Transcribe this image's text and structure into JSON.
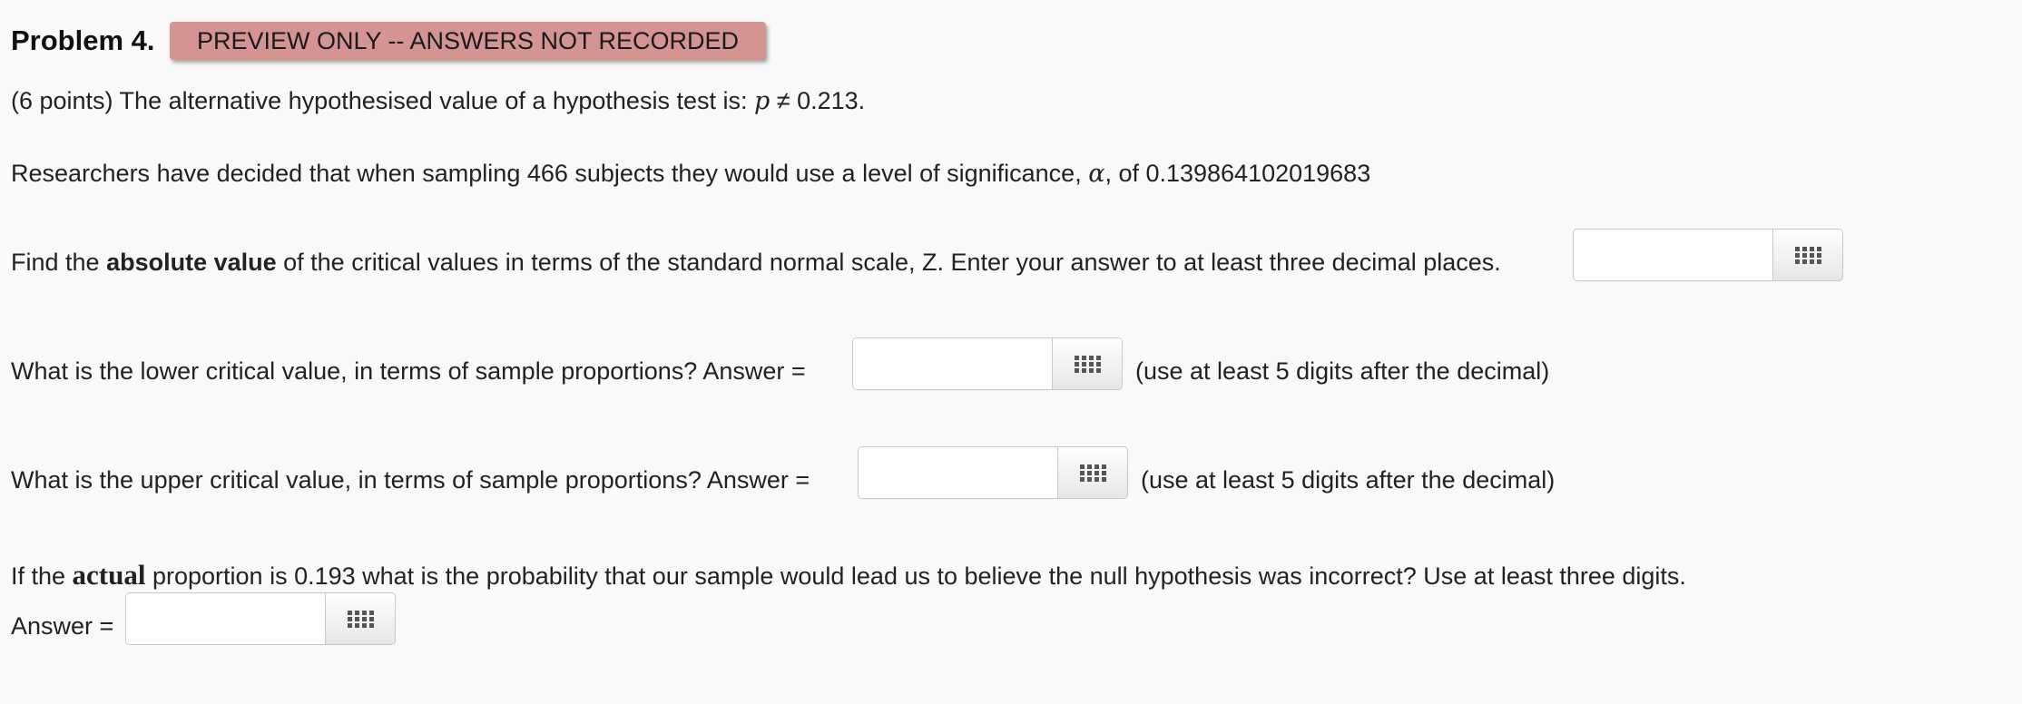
{
  "header": {
    "title": "Problem 4.",
    "badge": "PREVIEW ONLY -- ANSWERS NOT RECORDED"
  },
  "intro": {
    "prefix": "(6 points) The alternative hypothesised value of a hypothesis test is: ",
    "var": "p",
    "op": " ≠ ",
    "value": "0.213."
  },
  "researchers": {
    "prefix": "Researchers have decided that when sampling 466 subjects they would use a level of significance, ",
    "alpha": "α",
    "suffix": ", of 0.139864102019683"
  },
  "q1": {
    "prefix": "Find the ",
    "bold": "absolute value",
    "suffix": " of the critical values in terms of the standard normal scale, Z. Enter your answer to at least three decimal places.",
    "value": ""
  },
  "q2": {
    "text": "What is the lower critical value, in terms of sample proportions? Answer =",
    "hint": "(use at least 5 digits after the decimal)",
    "value": ""
  },
  "q3": {
    "text": "What is the upper critical value, in terms of sample proportions? Answer =",
    "hint": "(use at least 5 digits after the decimal)",
    "value": ""
  },
  "q4": {
    "prefix": "If the ",
    "bold": "actual",
    "suffix": " proportion is 0.193 what is the probability that our sample would lead us to believe the null hypothesis was incorrect? Use at least three digits.",
    "answer_label": "Answer =",
    "value": ""
  },
  "icons": {
    "keyboard": "grid-keypad-icon"
  }
}
